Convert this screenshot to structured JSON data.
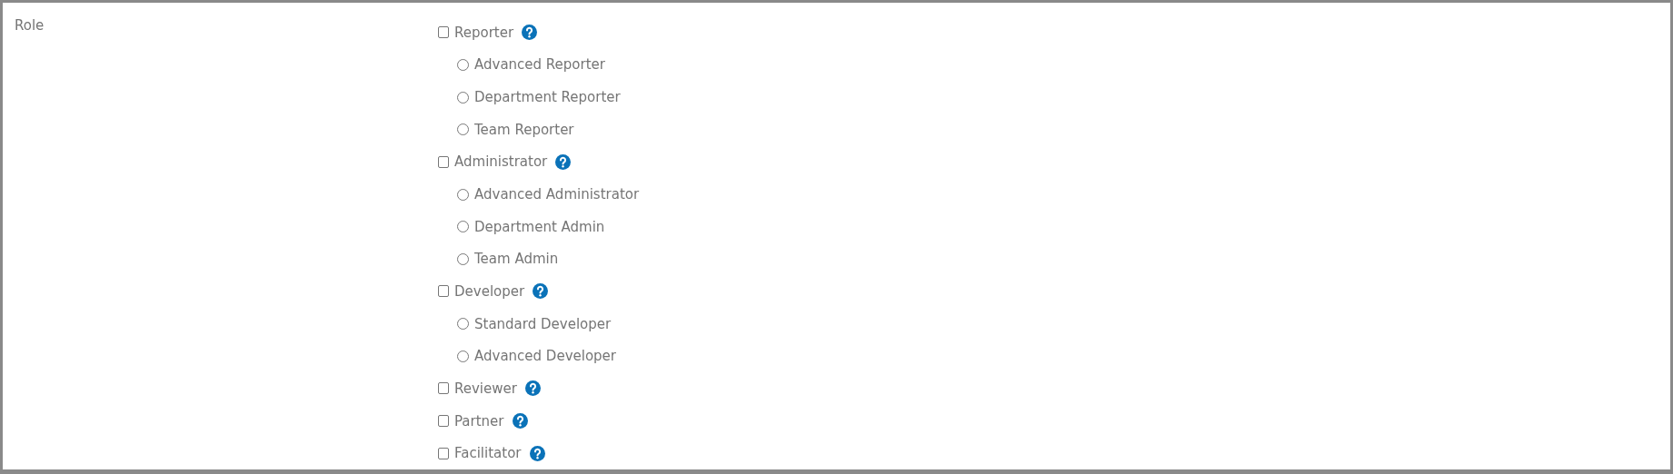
{
  "field": {
    "label": "Role"
  },
  "roles": [
    {
      "label": "Reporter",
      "checked": false,
      "children": [
        {
          "label": "Advanced Reporter",
          "selected": false
        },
        {
          "label": "Department Reporter",
          "selected": false
        },
        {
          "label": "Team Reporter",
          "selected": false
        }
      ]
    },
    {
      "label": "Administrator",
      "checked": false,
      "children": [
        {
          "label": "Advanced Administrator",
          "selected": false
        },
        {
          "label": "Department Admin",
          "selected": false
        },
        {
          "label": "Team Admin",
          "selected": false
        }
      ]
    },
    {
      "label": "Developer",
      "checked": false,
      "children": [
        {
          "label": "Standard Developer",
          "selected": false
        },
        {
          "label": "Advanced Developer",
          "selected": false
        }
      ]
    },
    {
      "label": "Reviewer",
      "checked": false
    },
    {
      "label": "Partner",
      "checked": false
    },
    {
      "label": "Facilitator",
      "checked": false
    }
  ]
}
